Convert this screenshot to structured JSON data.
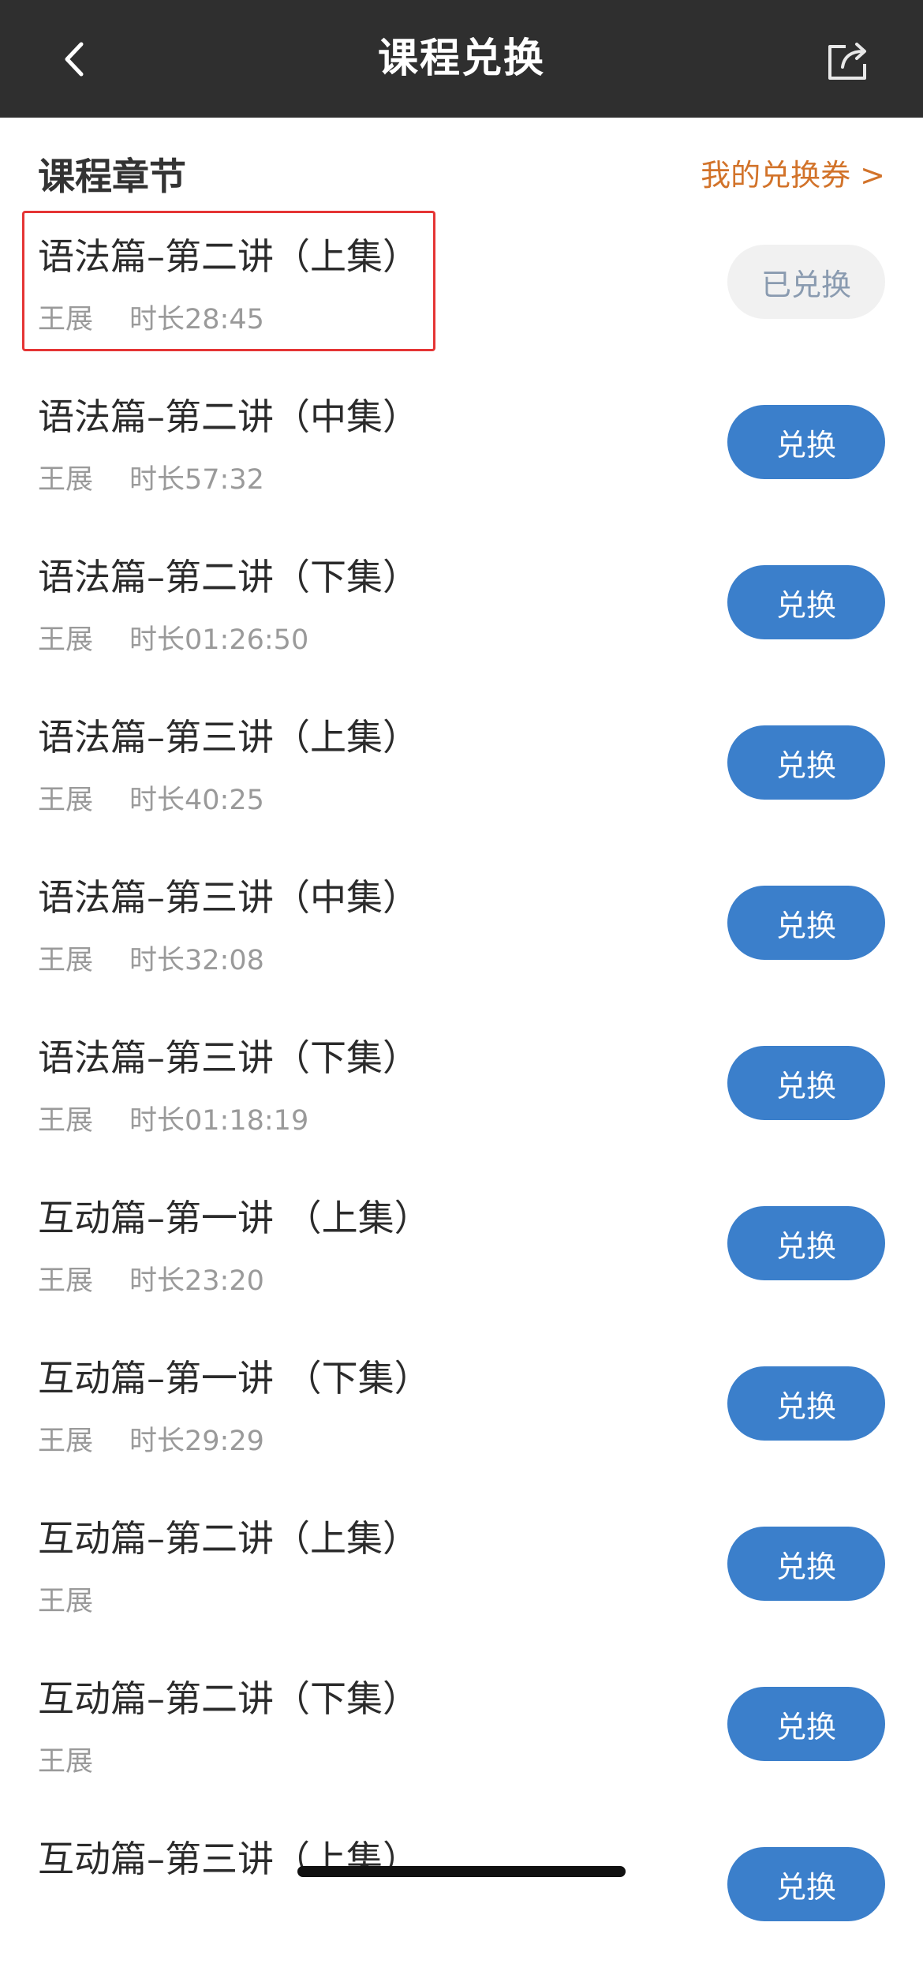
{
  "nav": {
    "title": "课程兑换"
  },
  "section": {
    "title": "课程章节",
    "my_coupon_link": "我的兑换券 >"
  },
  "colors": {
    "nav_bg": "#2f2f2f",
    "accent_blue": "#3b7fcb",
    "link_orange": "#d2732a",
    "highlight_red": "#e53535"
  },
  "icons": {
    "back": "chevron-left-icon",
    "share": "share-icon"
  },
  "chapters": [
    {
      "title": "语法篇–第二讲（上集）",
      "teacher": "王展",
      "duration": "时长28:45",
      "button": "已兑换",
      "redeemed": true
    },
    {
      "title": "语法篇–第二讲（中集）",
      "teacher": "王展",
      "duration": "时长57:32",
      "button": "兑换",
      "redeemed": false
    },
    {
      "title": "语法篇–第二讲（下集）",
      "teacher": "王展",
      "duration": "时长01:26:50",
      "button": "兑换",
      "redeemed": false
    },
    {
      "title": "语法篇–第三讲（上集）",
      "teacher": "王展",
      "duration": "时长40:25",
      "button": "兑换",
      "redeemed": false
    },
    {
      "title": "语法篇–第三讲（中集）",
      "teacher": "王展",
      "duration": "时长32:08",
      "button": "兑换",
      "redeemed": false
    },
    {
      "title": "语法篇–第三讲（下集）",
      "teacher": "王展",
      "duration": "时长01:18:19",
      "button": "兑换",
      "redeemed": false
    },
    {
      "title": "互动篇–第一讲 （上集）",
      "teacher": "王展",
      "duration": "时长23:20",
      "button": "兑换",
      "redeemed": false
    },
    {
      "title": "互动篇–第一讲 （下集）",
      "teacher": "王展",
      "duration": "时长29:29",
      "button": "兑换",
      "redeemed": false
    },
    {
      "title": "互动篇–第二讲（上集）",
      "teacher": "王展",
      "duration": "",
      "button": "兑换",
      "redeemed": false
    },
    {
      "title": "互动篇–第二讲（下集）",
      "teacher": "王展",
      "duration": "",
      "button": "兑换",
      "redeemed": false
    },
    {
      "title": "互动篇–第三讲（上集）",
      "teacher": "",
      "duration": "",
      "button": "兑换",
      "redeemed": false
    }
  ]
}
